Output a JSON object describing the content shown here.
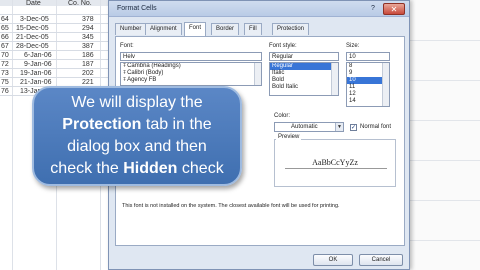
{
  "sheet": {
    "headers": {
      "date": "Date",
      "co_no": "Co. No."
    },
    "rows": [
      {
        "row": "",
        "date": "",
        "co": ""
      },
      {
        "row": "64",
        "date": "3-Dec-05",
        "co": "378"
      },
      {
        "row": "65",
        "date": "15-Dec-05",
        "co": "294"
      },
      {
        "row": "66",
        "date": "21-Dec-05",
        "co": "345"
      },
      {
        "row": "67",
        "date": "28-Dec-05",
        "co": "387"
      },
      {
        "row": "70",
        "date": "6-Jan-06",
        "co": "186"
      },
      {
        "row": "72",
        "date": "9-Jan-06",
        "co": "187"
      },
      {
        "row": "73",
        "date": "19-Jan-06",
        "co": "202"
      },
      {
        "row": "75",
        "date": "21-Jan-06",
        "co": "221"
      },
      {
        "row": "76",
        "date": "13-Jan-06",
        "co": "230"
      }
    ]
  },
  "dialog": {
    "title": "Format Cells",
    "help": "?",
    "close": "✕",
    "tabs": [
      "Number",
      "Alignment",
      "Font",
      "Border",
      "Fill",
      "Protection"
    ],
    "active_tab": "Font",
    "font_label": "Font:",
    "font_value": "Helv",
    "font_list": [
      "Cambria (Headings)",
      "Calibri (Body)",
      "Agency FB"
    ],
    "font_icon": "truetype-font-icon",
    "style_label": "Font style:",
    "style_value": "Regular",
    "style_list": [
      "Regular",
      "Italic",
      "Bold",
      "Bold Italic"
    ],
    "size_label": "Size:",
    "size_value": "10",
    "size_list": [
      "8",
      "9",
      "10",
      "11",
      "12",
      "14"
    ],
    "color_label": "Color:",
    "color_value": "Automatic",
    "normal_font_label": "Normal font",
    "normal_font_checked": true,
    "preview_label": "Preview",
    "preview_text": "AaBbCcYyZz",
    "info_text": "This font is not installed on the system.  The closest available font will be used for printing.",
    "ok": "OK",
    "cancel": "Cancel"
  },
  "callout": {
    "line1": "We will display the",
    "line2_bold": "Protection",
    "line2_rest": " tab in the",
    "line3": "dialog box and then",
    "line4_pre": "check the ",
    "line4_bold": "Hidden",
    "line4_post": " check"
  },
  "colors": {
    "callout_bg": "#4a7bbd",
    "selection": "#3875d7",
    "close_button": "#c8493b"
  }
}
